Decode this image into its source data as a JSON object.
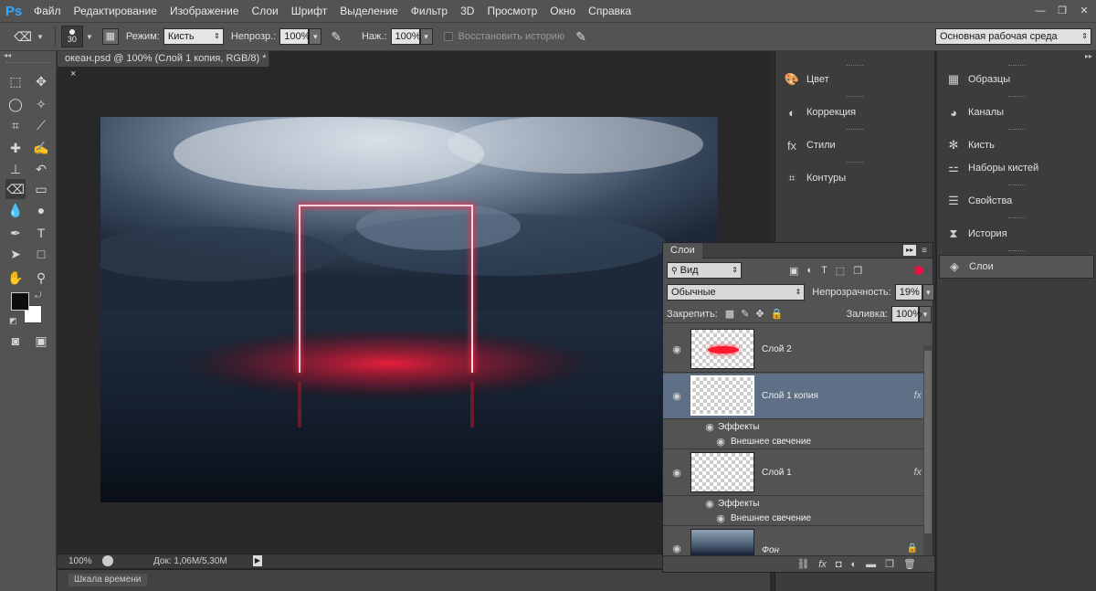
{
  "menu": {
    "logo": "Ps",
    "items": [
      "Файл",
      "Редактирование",
      "Изображение",
      "Слои",
      "Шрифт",
      "Выделение",
      "Фильтр",
      "3D",
      "Просмотр",
      "Окно",
      "Справка"
    ]
  },
  "window_controls": {
    "minimize": "—",
    "restore": "❐",
    "close": "✕"
  },
  "options": {
    "brush_size": "30",
    "mode_label": "Режим:",
    "mode_value": "Кисть",
    "opacity_label": "Непрозр.:",
    "opacity_value": "100%",
    "pressure_label": "Наж.:",
    "pressure_value": "100%",
    "restore_history_label": "Восстановить историю",
    "workspace_value": "Основная рабочая среда"
  },
  "document": {
    "tab_title": "океан.psd @ 100% (Слой 1 копия, RGB/8) *",
    "tab_close": "×",
    "zoom": "100%",
    "doc_info": "Док: 1,06M/5,30M",
    "timeline_label": "Шкала времени"
  },
  "panels_col1": [
    "Цвет",
    "Коррекция",
    "Стили",
    "Контуры"
  ],
  "panels_col2": [
    "Образцы",
    "Каналы",
    "Кисть",
    "Наборы кистей",
    "Свойства",
    "История",
    "Слои"
  ],
  "layers_panel": {
    "title": "Слои",
    "filter_value": "Вид",
    "blend_value": "Обычные",
    "opacity_label": "Непрозрачность:",
    "opacity_value": "19%",
    "lock_label": "Закрепить:",
    "fill_label": "Заливка:",
    "fill_value": "100%",
    "layers": [
      {
        "name": "Слой 2",
        "selected": false,
        "fx": false
      },
      {
        "name": "Слой 1 копия",
        "selected": true,
        "fx": true,
        "effects_label": "Эффекты",
        "effect": "Внешнее свечение"
      },
      {
        "name": "Слой 1",
        "selected": false,
        "fx": true,
        "effects_label": "Эффекты",
        "effect": "Внешнее свечение"
      },
      {
        "name": "Фон",
        "selected": false,
        "fx": false,
        "locked": true
      }
    ],
    "fx_label": "fx"
  },
  "colors": {
    "accent": "#31a8ff",
    "neon": "#ff2a4a",
    "selection": "#5f6f86"
  }
}
